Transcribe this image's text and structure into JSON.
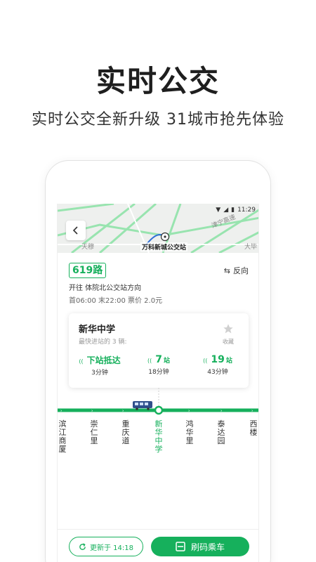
{
  "promo": {
    "title": "实时公交",
    "subtitle": "实时公交全新升级 31城市抢先体验"
  },
  "status_bar": {
    "time": "11:29"
  },
  "map": {
    "labels": [
      "天穆",
      "万科新城公交站",
      "津宁高速",
      "大毕"
    ],
    "stop_name": "万科新城公交站"
  },
  "route": {
    "number": "619路",
    "direction": "开往 体院北公交站方向",
    "times": "首06:00  末22:00  票价 2.0元",
    "reverse_label": "反向"
  },
  "arrival_card": {
    "stop_name": "新华中学",
    "note": "最快进站的 3 辆:",
    "favorite_label": "收藏",
    "arrivals": [
      {
        "main": "下站抵达",
        "time": "3分钟"
      },
      {
        "count": "7",
        "unit": "站",
        "time": "18分钟"
      },
      {
        "count": "19",
        "unit": "站",
        "time": "43分钟"
      }
    ]
  },
  "stations": [
    {
      "name": "滨江商厦",
      "current": false
    },
    {
      "name": "崇仁里",
      "current": false
    },
    {
      "name": "重庆道",
      "current": false
    },
    {
      "name": "新华中学",
      "current": true
    },
    {
      "name": "鸿华里",
      "current": false
    },
    {
      "name": "泰达园",
      "current": false
    },
    {
      "name": "西楼",
      "current": false
    }
  ],
  "bottom": {
    "refresh_label": "更新于 14:18",
    "scan_label": "刷码乘车"
  },
  "colors": {
    "accent": "#16b05c",
    "map_road": "#7ddc9a"
  },
  "icons": [
    "back-icon",
    "reverse-icon",
    "star-icon",
    "signal-icon",
    "bus-icon",
    "refresh-icon",
    "qr-scan-icon",
    "wifi-icon",
    "battery-icon",
    "location-pin-icon"
  ]
}
